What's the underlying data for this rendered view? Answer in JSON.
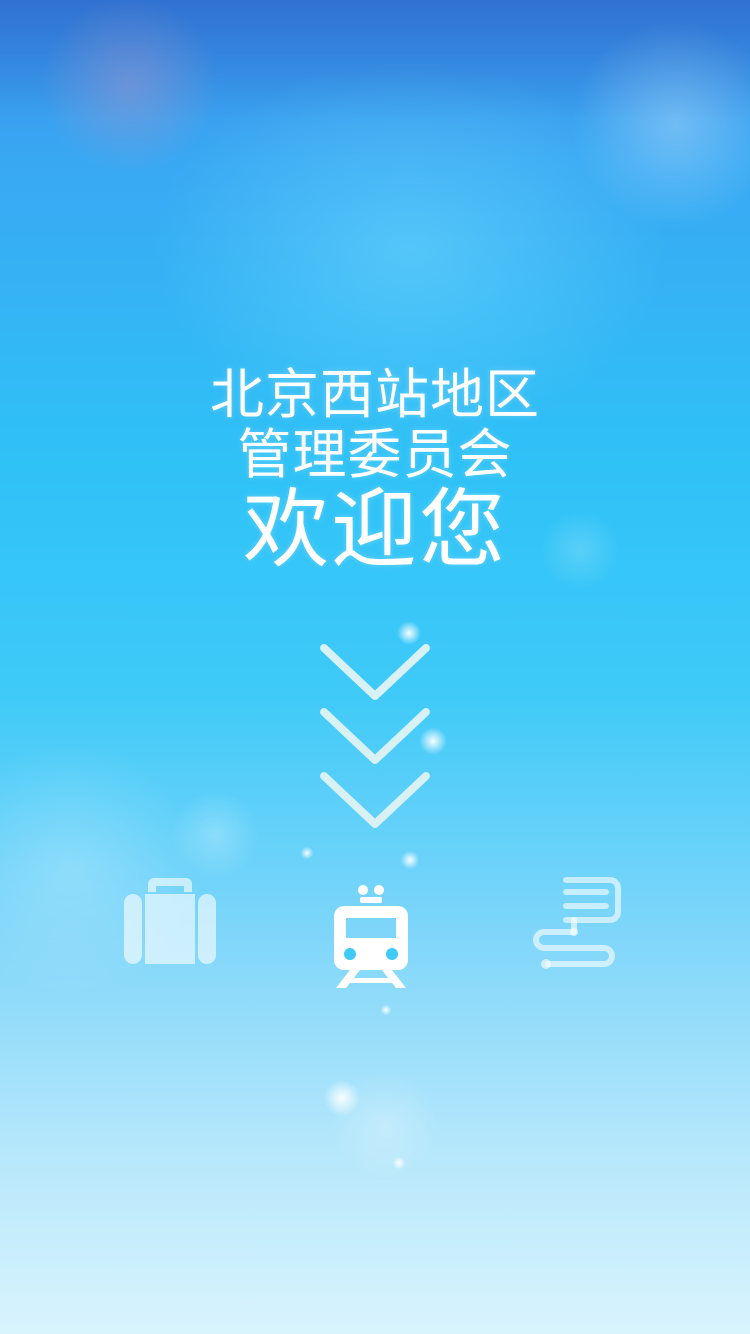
{
  "welcome": {
    "line1": "北京西站地区",
    "line2": "管理委员会",
    "line3": "欢迎您"
  },
  "scroll_hint": {
    "icon": "chevron-down-icon",
    "count": 3,
    "color": "#d8f1f4"
  },
  "nav_icons": [
    {
      "name": "luggage-icon",
      "active": false
    },
    {
      "name": "train-icon",
      "active": true
    },
    {
      "name": "route-info-icon",
      "active": false
    }
  ],
  "colors": {
    "background_top": "#3a8fe6",
    "background_mid": "#2fc2f7",
    "background_bottom": "#d9f4fd",
    "text": "#ffffff",
    "icon_inactive": "rgba(255,255,255,0.6)",
    "icon_active": "#ffffff"
  }
}
